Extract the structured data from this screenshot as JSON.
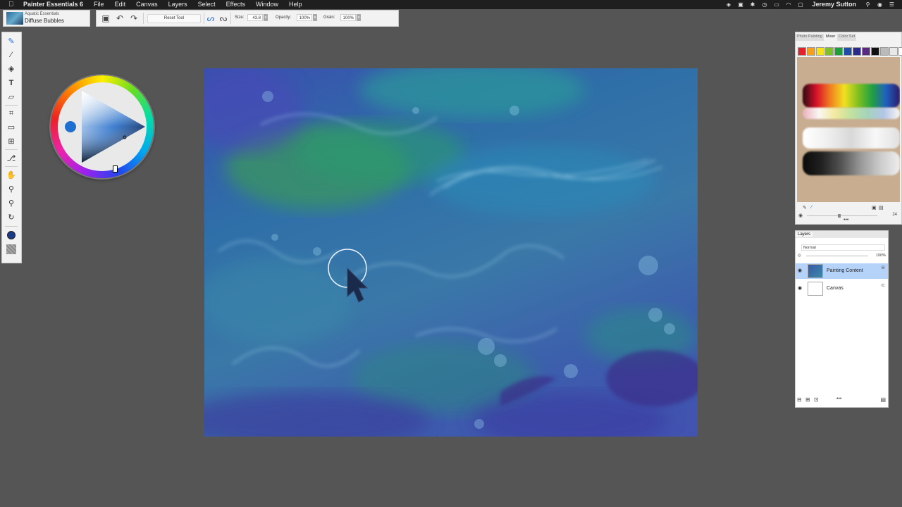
{
  "menubar": {
    "apple": "",
    "app_name": "Painter Essentials 6",
    "items": [
      "File",
      "Edit",
      "Canvas",
      "Layers",
      "Select",
      "Effects",
      "Window",
      "Help"
    ],
    "status_icons": [
      "dropbox-icon",
      "screen-record-icon",
      "bluetooth-icon",
      "time-machine-icon",
      "battery-icon",
      "wifi-icon",
      "airplay-icon"
    ],
    "user": "Jeremy Sutton"
  },
  "brush_selector": {
    "category": "Aquatic Essentials",
    "variant": "Diffuse Bubbles"
  },
  "property_bar": {
    "reset_label": "Reset Tool",
    "size_label": "Size:",
    "size_value": "43.8",
    "opacity_label": "Opacity:",
    "opacity_value": "100%",
    "grain_label": "Grain:",
    "grain_value": "100%"
  },
  "mixer": {
    "tabs": [
      "Photo Painting",
      "Mixer",
      "Color Set"
    ],
    "active_tab": "Mixer",
    "swatches": [
      "#e0222a",
      "#f2a01e",
      "#f5e21a",
      "#7cc02a",
      "#1e9e3a",
      "#1e4ea8",
      "#2a2a8a",
      "#5a2a80",
      "#111111",
      "#bbbbbb",
      "#e8e8e8",
      "#ffffff"
    ],
    "brush_size": "24",
    "background": "#c8ad90"
  },
  "layers": {
    "tab": "Layers",
    "blend_mode": "Normal",
    "opacity": "100%",
    "items": [
      {
        "name": "Painting Content",
        "selected": true
      },
      {
        "name": "Canvas",
        "selected": false
      }
    ]
  },
  "colors": {
    "accent": "#2a6fd6",
    "background": "#555555",
    "current_color": "#1e6fd0"
  }
}
